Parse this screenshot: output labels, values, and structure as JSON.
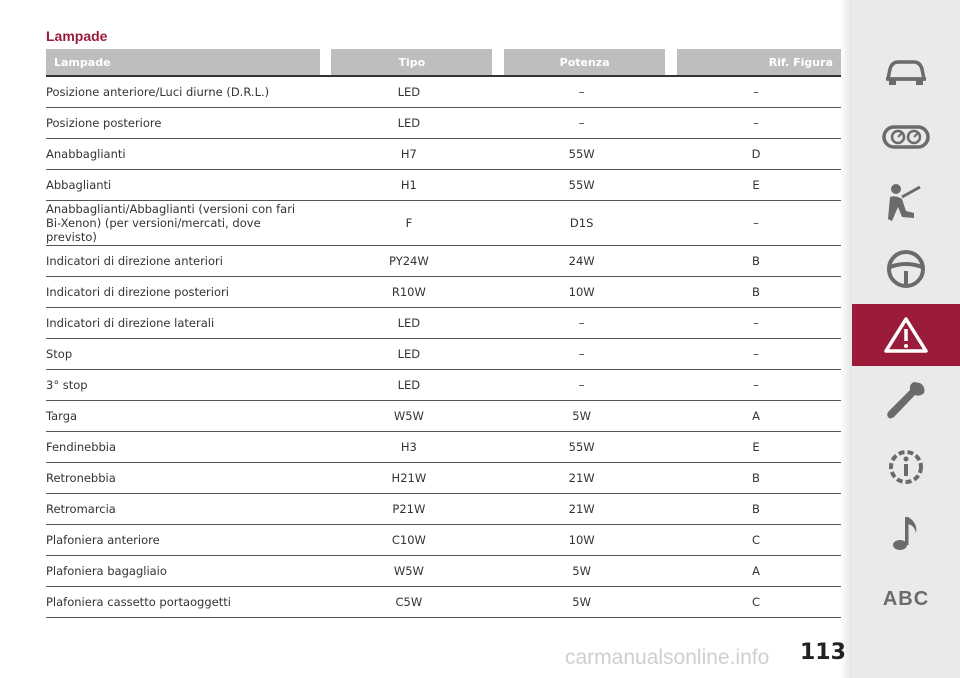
{
  "section_title": "Lampade",
  "table": {
    "headers": [
      "Lampade",
      "Tipo",
      "Potenza",
      "Rif. Figura"
    ],
    "rows": [
      [
        "Posizione anteriore/Luci diurne (D.R.L.)",
        "LED",
        "–",
        "–"
      ],
      [
        "Posizione posteriore",
        "LED",
        "–",
        "–"
      ],
      [
        "Anabbaglianti",
        "H7",
        "55W",
        "D"
      ],
      [
        "Abbaglianti",
        "H1",
        "55W",
        "E"
      ],
      [
        "Anabbaglianti/Abbaglianti (versioni con fari Bi-Xenon) (per versioni/mercati, dove previsto)",
        "F",
        "D1S",
        "–"
      ],
      [
        "Indicatori di direzione anteriori",
        "PY24W",
        "24W",
        "B"
      ],
      [
        "Indicatori di direzione posteriori",
        "R10W",
        "10W",
        "B"
      ],
      [
        "Indicatori di direzione laterali",
        "LED",
        "–",
        "–"
      ],
      [
        "Stop",
        "LED",
        "–",
        "–"
      ],
      [
        "3° stop",
        "LED",
        "–",
        "–"
      ],
      [
        "Targa",
        "W5W",
        "5W",
        "A"
      ],
      [
        "Fendinebbia",
        "H3",
        "55W",
        "E"
      ],
      [
        "Retronebbia",
        "H21W",
        "21W",
        "B"
      ],
      [
        "Retromarcia",
        "P21W",
        "21W",
        "B"
      ],
      [
        "Plafoniera anteriore",
        "C10W",
        "10W",
        "C"
      ],
      [
        "Plafoniera bagagliaio",
        "W5W",
        "5W",
        "A"
      ],
      [
        "Plafoniera cassetto portaoggetti",
        "C5W",
        "5W",
        "C"
      ]
    ]
  },
  "page_number": "113",
  "sidebar": {
    "items": [
      {
        "icon": "car-icon"
      },
      {
        "icon": "dashboard-gauges-icon"
      },
      {
        "icon": "seatbelt-passenger-icon"
      },
      {
        "icon": "steering-wheel-icon"
      },
      {
        "icon": "warning-triangle-icon",
        "active": true
      },
      {
        "icon": "wrench-icon"
      },
      {
        "icon": "info-gear-icon"
      },
      {
        "icon": "music-note-icon"
      },
      {
        "label": "ABC"
      }
    ],
    "active_color": "#9b1c3a",
    "icon_color": "#6b6b6b"
  },
  "watermark": "carmanualsonline.info",
  "colors": {
    "accent": "#9b1c3a",
    "header_bg": "#bebebe"
  }
}
